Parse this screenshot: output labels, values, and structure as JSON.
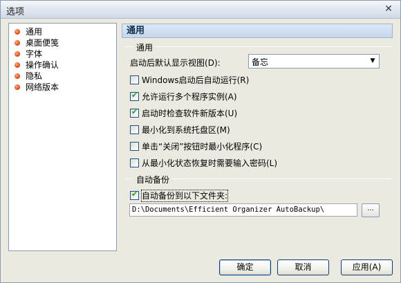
{
  "window": {
    "title": "选项",
    "close_glyph": "✕"
  },
  "sidebar": {
    "items": [
      {
        "label": "通用"
      },
      {
        "label": "桌面便笺"
      },
      {
        "label": "字体"
      },
      {
        "label": "操作确认"
      },
      {
        "label": "隐私"
      },
      {
        "label": "网络版本"
      }
    ]
  },
  "section": {
    "title": "通用"
  },
  "general_group": {
    "label": "通用",
    "startup_view_label": "启动后默认显示视图",
    "startup_view_shortcut": "(D):",
    "startup_view_value": "备忘"
  },
  "options": [
    {
      "label": "Windows启动后自动运行(R)",
      "checked": false
    },
    {
      "label": "允许运行多个程序实例(A)",
      "checked": true
    },
    {
      "label": "启动时检查软件新版本(U)",
      "checked": true
    },
    {
      "label": "最小化到系统托盘区(M)",
      "checked": false
    },
    {
      "label": "单击“关闭”按钮时最小化程序(C)",
      "checked": false
    },
    {
      "label": "从最小化状态恢复时需要输入密码(L)",
      "checked": false
    }
  ],
  "backup_group": {
    "label": "自动备份",
    "enable_label": "自动备份到以下文件夹:",
    "enable_checked": true,
    "path_value": "D:\\Documents\\Efficient Organizer AutoBackup\\",
    "browse_label": "..."
  },
  "buttons": {
    "ok": "确定",
    "cancel": "取消",
    "apply": "应用(A)"
  }
}
